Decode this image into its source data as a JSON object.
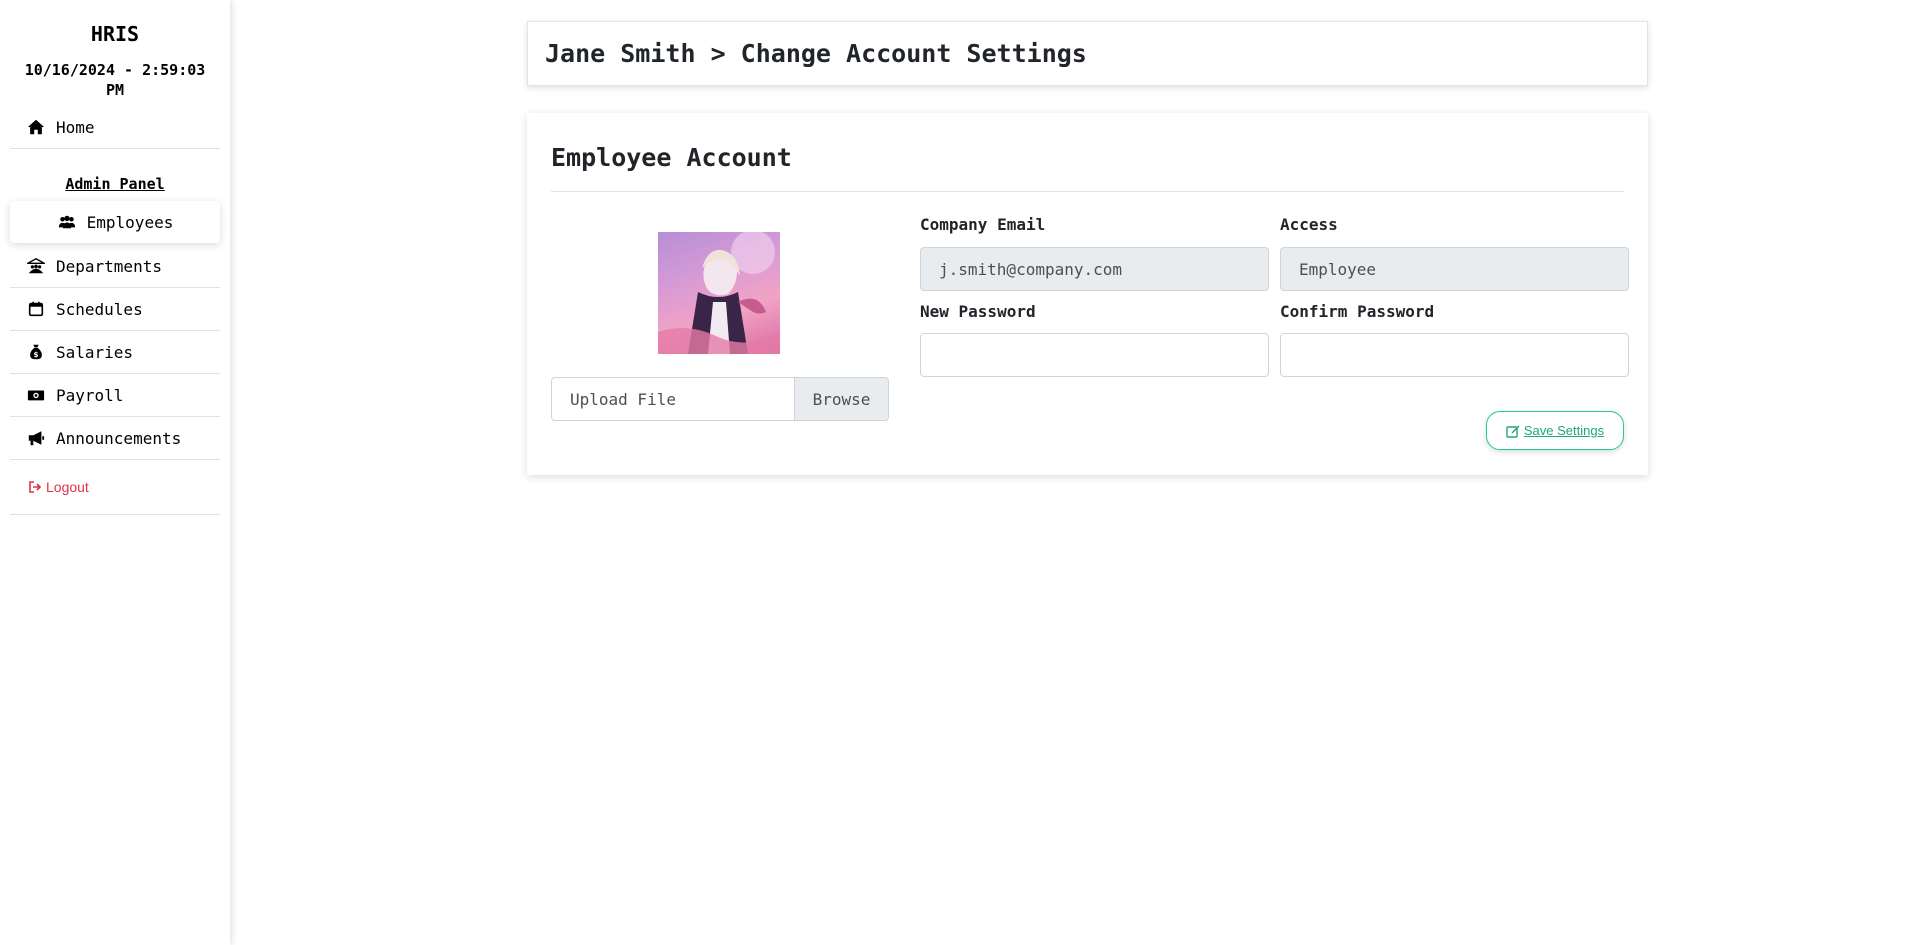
{
  "sidebar": {
    "brand": "HRIS",
    "datetime": "10/16/2024 - 2:59:03 PM",
    "home_label": "Home",
    "admin_title": "Admin Panel",
    "items": [
      {
        "label": "Employees",
        "icon": "users-icon",
        "active": true
      },
      {
        "label": "Departments",
        "icon": "building-icon"
      },
      {
        "label": "Schedules",
        "icon": "calendar-icon"
      },
      {
        "label": "Salaries",
        "icon": "money-bag-icon"
      },
      {
        "label": "Payroll",
        "icon": "banknote-icon"
      },
      {
        "label": "Announcements",
        "icon": "megaphone-icon"
      }
    ],
    "logout_label": "Logout"
  },
  "header": {
    "breadcrumb": "Jane Smith > Change Account Settings"
  },
  "card": {
    "title": "Employee Account",
    "upload": {
      "label": "Upload File",
      "browse_label": "Browse"
    },
    "company_email": {
      "label": "Company Email",
      "value": "j.smith@company.com"
    },
    "access": {
      "label": "Access",
      "value": "Employee"
    },
    "new_password": {
      "label": "New Password",
      "value": ""
    },
    "confirm_password": {
      "label": "Confirm Password",
      "value": ""
    },
    "save_label": "Save Settings"
  },
  "colors": {
    "danger": "#dc3545",
    "success": "#20c997",
    "readonly_bg": "#e9ecef"
  }
}
